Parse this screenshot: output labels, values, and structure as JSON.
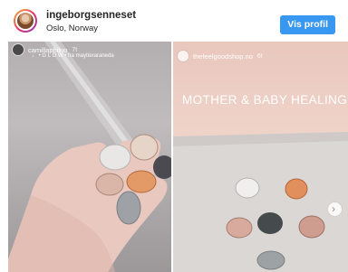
{
  "header": {
    "username": "ingeborgsenneset",
    "location": "Oslo, Norway",
    "profile_button": "Vis profil"
  },
  "stories": [
    {
      "author": "camillaphilno",
      "time": "7t",
      "music": "♩ • G L O W • fra maytteraraneda"
    },
    {
      "author": "thefeelgoodshop.no",
      "time": "6t",
      "title_text": "MOTHER & BABY HEALING KIT"
    }
  ],
  "colors": {
    "accent": "#3897f0",
    "story_right_bg": "#efd3c9",
    "story_left_bg": "#b8b4b5"
  },
  "icons": {
    "next": "chevron-right-icon"
  }
}
